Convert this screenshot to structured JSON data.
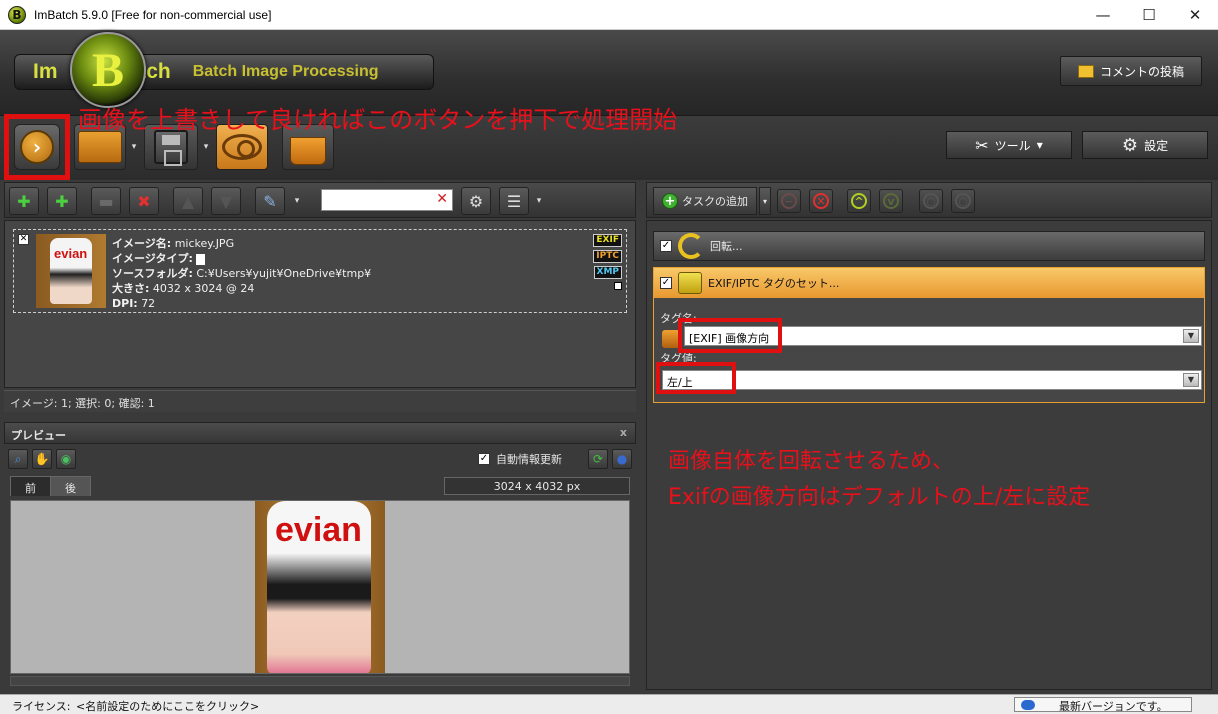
{
  "window": {
    "title": "ImBatch 5.9.0 [Free for non-commercial use]",
    "logo_letter": "B",
    "minimize": "—",
    "maximize": "☐",
    "close": "✕"
  },
  "banner": {
    "brand_left": "Im",
    "brand_ball": "B",
    "brand_right": "atch",
    "tagline": "Batch Image Processing",
    "comment_button": "コメントの投稿"
  },
  "toolbar": {
    "tools_button": "ツール",
    "settings_button": "設定",
    "run_glyph": "›",
    "drop_glyph": "▾"
  },
  "annotations": {
    "top_note": "画像を上書きして良ければこのボタンを押下で処理開始",
    "right_note_line1": "画像自体を回転させるため、",
    "right_note_line2": "Exifの画像方向はデフォルトの上/左に設定"
  },
  "search": {
    "value": "",
    "clear_glyph": "✕"
  },
  "image_list": {
    "items": [
      {
        "checked_glyph": "✕",
        "thumb_text": "evian",
        "name_label": "イメージ名:",
        "name_value": "mickey.JPG",
        "type_label": "イメージタイプ:",
        "type_value": "",
        "folder_label": "ソースフォルダ:",
        "folder_value": "C:¥Users¥yujit¥OneDrive¥tmp¥",
        "size_label": "大きさ:",
        "size_value": "4032 x 3024 @ 24",
        "dpi_label": "DPI:",
        "dpi_value": "72",
        "badges": [
          "EXIF",
          "IPTC",
          "XMP"
        ]
      }
    ],
    "status": "イメージ: 1; 選択: 0; 確認: 1"
  },
  "preview": {
    "title": "プレビュー",
    "close_glyph": "x",
    "auto_update_label": "自動情報更新",
    "auto_update_checked": true,
    "tabs": [
      "前",
      "後"
    ],
    "active_tab": "後",
    "dimensions": "3024 x 4032 px",
    "photo_text": "evian"
  },
  "tasks": {
    "add_task_button": "タスクの追加",
    "items": [
      {
        "label": "回転...",
        "checked": true
      },
      {
        "label": "EXIF/IPTC タグのセット...",
        "checked": true
      }
    ],
    "tag_name_label": "タグ名:",
    "tag_name_value": "[EXIF] 画像方向",
    "tag_value_label": "タグ値:",
    "tag_value_value": "左/上"
  },
  "statusbar": {
    "license_label": "ライセンス:",
    "license_value": "<名前設定のためにここをクリック>",
    "version_status": "最新バージョンです。"
  }
}
